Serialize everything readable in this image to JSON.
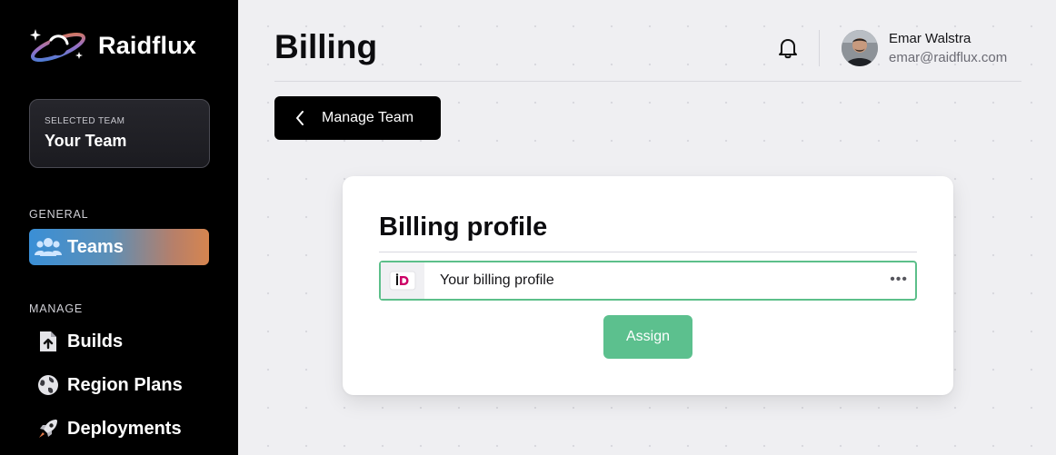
{
  "brand": {
    "name": "Raidflux"
  },
  "sidebar": {
    "team_caption": "SELECTED TEAM",
    "team_name": "Your Team",
    "sections": [
      {
        "label": "GENERAL",
        "items": [
          {
            "label": "Teams",
            "icon": "users-icon",
            "active": true
          }
        ]
      },
      {
        "label": "MANAGE",
        "items": [
          {
            "label": "Builds",
            "icon": "file-upload-icon"
          },
          {
            "label": "Region Plans",
            "icon": "globe-icon"
          },
          {
            "label": "Deployments",
            "icon": "rocket-icon"
          }
        ]
      }
    ]
  },
  "header": {
    "title": "Billing",
    "user": {
      "name": "Emar Walstra",
      "email": "emar@raidflux.com"
    }
  },
  "back_button": {
    "label": "Manage Team"
  },
  "billing_card": {
    "title": "Billing profile",
    "selected_profile": "Your billing profile",
    "profile_icon": "ideal-icon",
    "more_label": "•••",
    "assign_label": "Assign"
  },
  "colors": {
    "sidebar_bg": "#000000",
    "accent_green": "#5cc08e",
    "active_gradient_start": "#3a8fd6",
    "active_gradient_end": "#d6854f"
  }
}
